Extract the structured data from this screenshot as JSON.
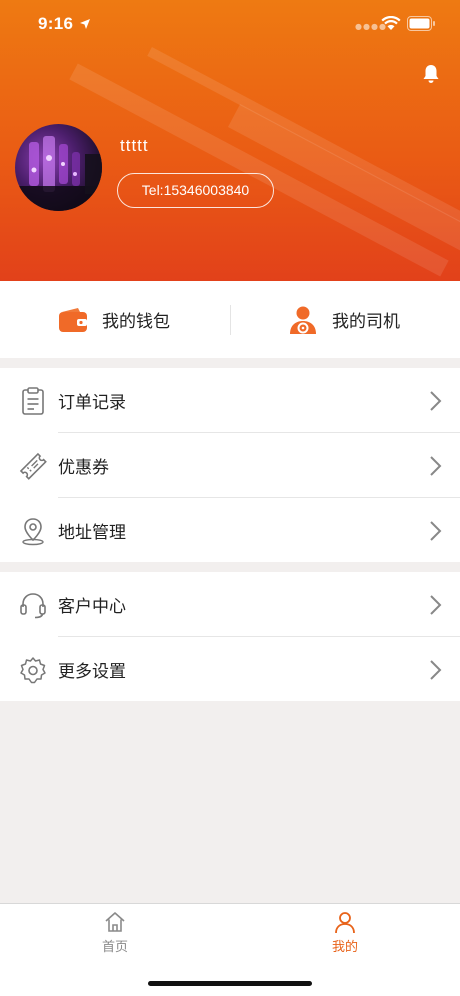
{
  "status_bar": {
    "time": "9:16"
  },
  "profile": {
    "username": "ttttt",
    "tel": "Tel:15346003840"
  },
  "quick_actions": [
    {
      "label": "我的钱包",
      "icon": "wallet-icon"
    },
    {
      "label": "我的司机",
      "icon": "driver-icon"
    }
  ],
  "menu_group_1": [
    {
      "label": "订单记录",
      "icon": "clipboard-icon"
    },
    {
      "label": "优惠券",
      "icon": "ticket-icon"
    },
    {
      "label": "地址管理",
      "icon": "location-pin-icon"
    }
  ],
  "menu_group_2": [
    {
      "label": "客户中心",
      "icon": "headset-icon"
    },
    {
      "label": "更多设置",
      "icon": "gear-icon"
    }
  ],
  "tabbar": {
    "tabs": [
      {
        "label": "首页",
        "icon": "home-icon",
        "active": false
      },
      {
        "label": "我的",
        "icon": "person-icon",
        "active": true
      }
    ]
  },
  "colors": {
    "accent": "#ea5c14",
    "tab_active": "#e8631a",
    "tab_inactive": "#8a8a8a"
  }
}
